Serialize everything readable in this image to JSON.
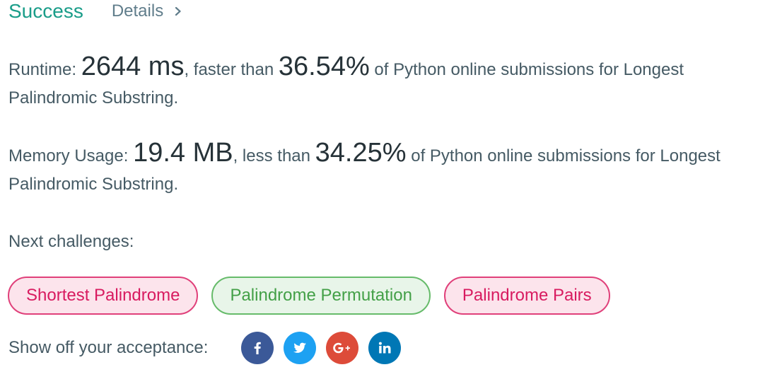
{
  "header": {
    "status": "Success",
    "details_label": "Details"
  },
  "runtime": {
    "label": "Runtime: ",
    "value": "2644 ms",
    "comparison": ", faster than ",
    "percent": "36.54%",
    "suffix": " of Python online submissions for Longest Palindromic Substring."
  },
  "memory": {
    "label": "Memory Usage: ",
    "value": "19.4 MB",
    "comparison": ", less than ",
    "percent": "34.25%",
    "suffix": " of Python online submissions for Longest Palindromic Substring."
  },
  "next": {
    "label": "Next challenges:",
    "challenges": [
      {
        "label": "Shortest Palindrome",
        "difficulty": "hard"
      },
      {
        "label": "Palindrome Permutation",
        "difficulty": "medium"
      },
      {
        "label": "Palindrome Pairs",
        "difficulty": "hard"
      }
    ]
  },
  "share": {
    "label": "Show off your acceptance:",
    "buttons": [
      {
        "icon": "facebook-icon",
        "color": "#3b5998"
      },
      {
        "icon": "twitter-icon",
        "color": "#1da1f2"
      },
      {
        "icon": "google-plus-icon",
        "color": "#dd4b39"
      },
      {
        "icon": "linkedin-icon",
        "color": "#0077b5"
      }
    ]
  },
  "colors": {
    "success": "#1a9d89",
    "hard": "#d81b60",
    "medium": "#43a047"
  }
}
